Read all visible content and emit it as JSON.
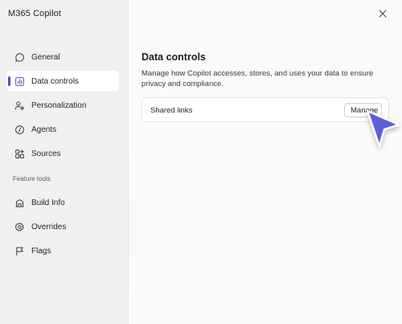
{
  "app": {
    "title": "M365 Copilot"
  },
  "sidebar": {
    "items": [
      {
        "label": "General",
        "icon": "chat-bubble-icon",
        "active": false
      },
      {
        "label": "Data controls",
        "icon": "data-bars-icon",
        "active": true
      },
      {
        "label": "Personalization",
        "icon": "person-settings-icon",
        "active": false
      },
      {
        "label": "Agents",
        "icon": "agent-code-icon",
        "active": false
      },
      {
        "label": "Sources",
        "icon": "apps-grid-icon",
        "active": false
      }
    ],
    "section_label": "Feature tools",
    "tools": [
      {
        "label": "Build Info",
        "icon": "build-icon"
      },
      {
        "label": "Overrides",
        "icon": "gear-icon"
      },
      {
        "label": "Flags",
        "icon": "flag-icon"
      }
    ]
  },
  "main": {
    "title": "Data controls",
    "description": "Manage how Copilot accesses, stores, and uses your data to ensure privacy and compliance.",
    "card": {
      "label": "Shared links",
      "button_label": "Manage"
    }
  },
  "colors": {
    "accent": "#4f52b2",
    "pointer": "#5b5fd6"
  }
}
